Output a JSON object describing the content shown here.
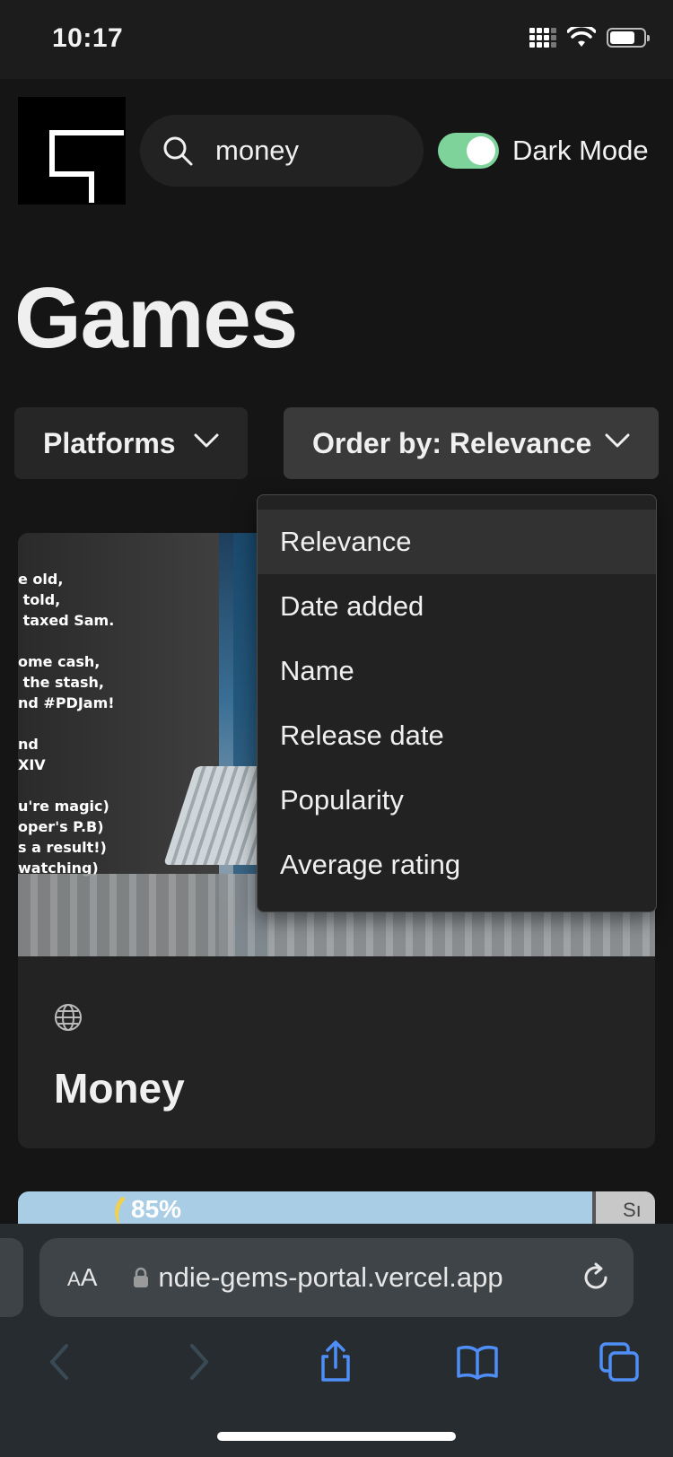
{
  "status_bar": {
    "time": "10:17",
    "battery_level": 0.75
  },
  "header": {
    "logo_name": "site-logo",
    "search": {
      "value": "money",
      "icon": "search-icon"
    },
    "dark_mode": {
      "label": "Dark Mode",
      "enabled": true,
      "color": "#7dd39a"
    }
  },
  "page": {
    "title": "Games"
  },
  "filters": {
    "platforms_label": "Platforms",
    "order_label": "Order by: Relevance"
  },
  "order_dropdown": {
    "selected": "Relevance",
    "options": [
      "Relevance",
      "Date added",
      "Name",
      "Release date",
      "Popularity",
      "Average rating"
    ]
  },
  "cards": [
    {
      "title": "Money",
      "platform_icon": "globe-icon",
      "image_text": "e old,\n told,\n taxed Sam.\n\nome cash,\n the stash,\nnd #PDJam!\n\nnd\nXIV\n\nu're magic)\noper's P.B)\ns a result!)\nwatching)"
    },
    {
      "image_text": "85%",
      "thumb_text": "Sı"
    }
  ],
  "browser": {
    "aa_label": "AA",
    "url": "indie-gems-portal.vercel.app",
    "url_shown": "ndie-gems-portal.vercel.app"
  }
}
